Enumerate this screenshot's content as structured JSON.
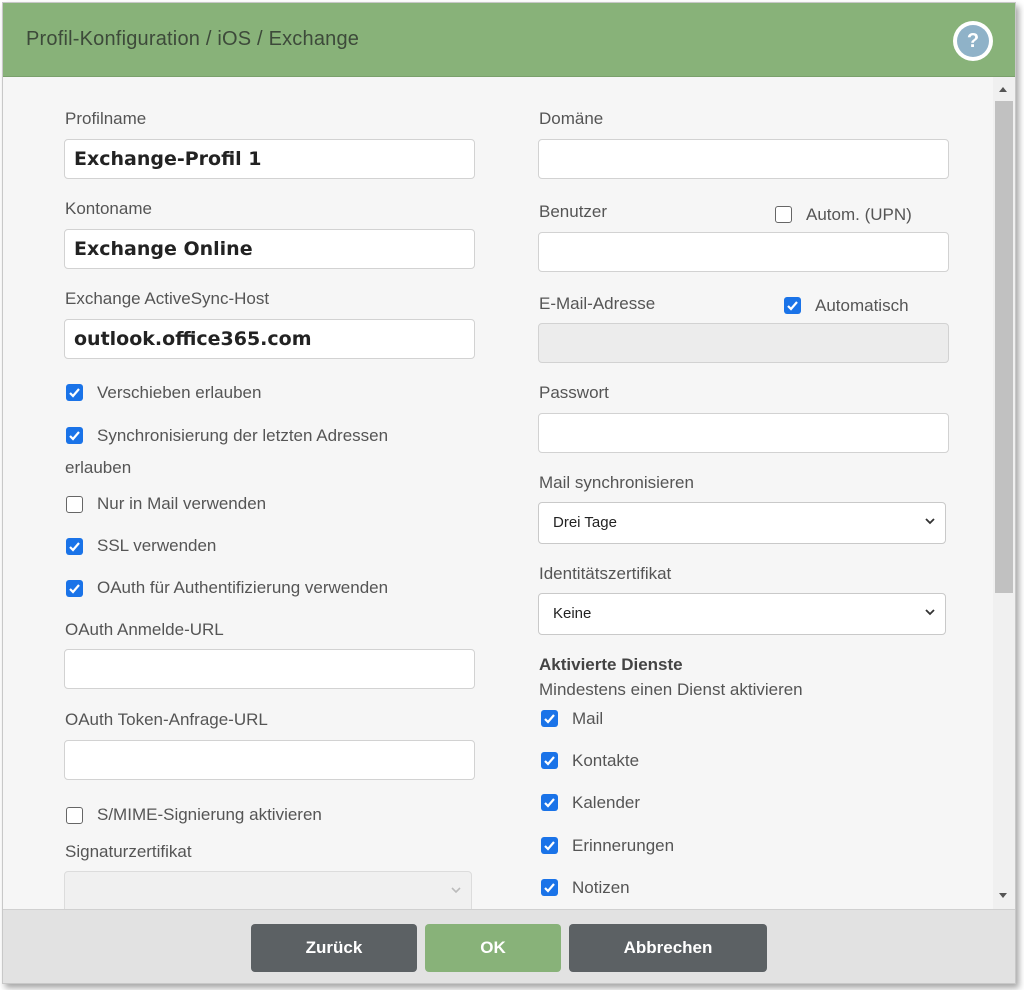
{
  "dialog": {
    "title": "Profil-Konfiguration / iOS / Exchange",
    "help_glyph": "?"
  },
  "left": {
    "profilname": {
      "label": "Profilname",
      "value": "Exchange-Profil 1"
    },
    "kontoname": {
      "label": "Kontoname",
      "value": "Exchange Online"
    },
    "host": {
      "label": "Exchange ActiveSync-Host",
      "value": "outlook.office365.com"
    },
    "checks": [
      {
        "label": "Verschieben erlauben",
        "checked": true
      },
      {
        "label": "Synchronisierung der letzten Adressen",
        "label2": "erlauben",
        "checked": true
      },
      {
        "label": "Nur in Mail verwenden",
        "checked": false
      },
      {
        "label": "SSL verwenden",
        "checked": true
      },
      {
        "label": "OAuth für Authentifizierung verwenden",
        "checked": true
      }
    ],
    "oauth_login": {
      "label": "OAuth Anmelde-URL",
      "value": ""
    },
    "oauth_token": {
      "label": "OAuth Token-Anfrage-URL",
      "value": ""
    },
    "smime": {
      "label": "S/MIME-Signierung aktivieren",
      "checked": false
    },
    "signature_cert": {
      "label": "Signaturzertifikat",
      "value": ""
    }
  },
  "right": {
    "domain": {
      "label": "Domäne",
      "value": ""
    },
    "user": {
      "label": "Benutzer",
      "value": "",
      "auto_label": "Autom. (UPN)",
      "auto_checked": false
    },
    "email": {
      "label": "E-Mail-Adresse",
      "value": "",
      "auto_label": "Automatisch",
      "auto_checked": true
    },
    "password": {
      "label": "Passwort",
      "value": ""
    },
    "mail_sync": {
      "label": "Mail synchronisieren",
      "selected": "Drei Tage"
    },
    "identity_cert": {
      "label": "Identitätszertifikat",
      "selected": "Keine"
    },
    "services": {
      "heading": "Aktivierte Dienste",
      "subheading": "Mindestens einen Dienst aktivieren",
      "items": [
        {
          "label": "Mail",
          "checked": true
        },
        {
          "label": "Kontakte",
          "checked": true
        },
        {
          "label": "Kalender",
          "checked": true
        },
        {
          "label": "Erinnerungen",
          "checked": true
        },
        {
          "label": "Notizen",
          "checked": true
        }
      ]
    }
  },
  "footer": {
    "back_label": "Zurück",
    "ok_label": "OK",
    "cancel_label": "Abbrechen"
  },
  "colors": {
    "header": "#88b279",
    "checkbox_on": "#1a73e8",
    "button_dark": "#5c6164",
    "button_ok": "#88b279"
  }
}
